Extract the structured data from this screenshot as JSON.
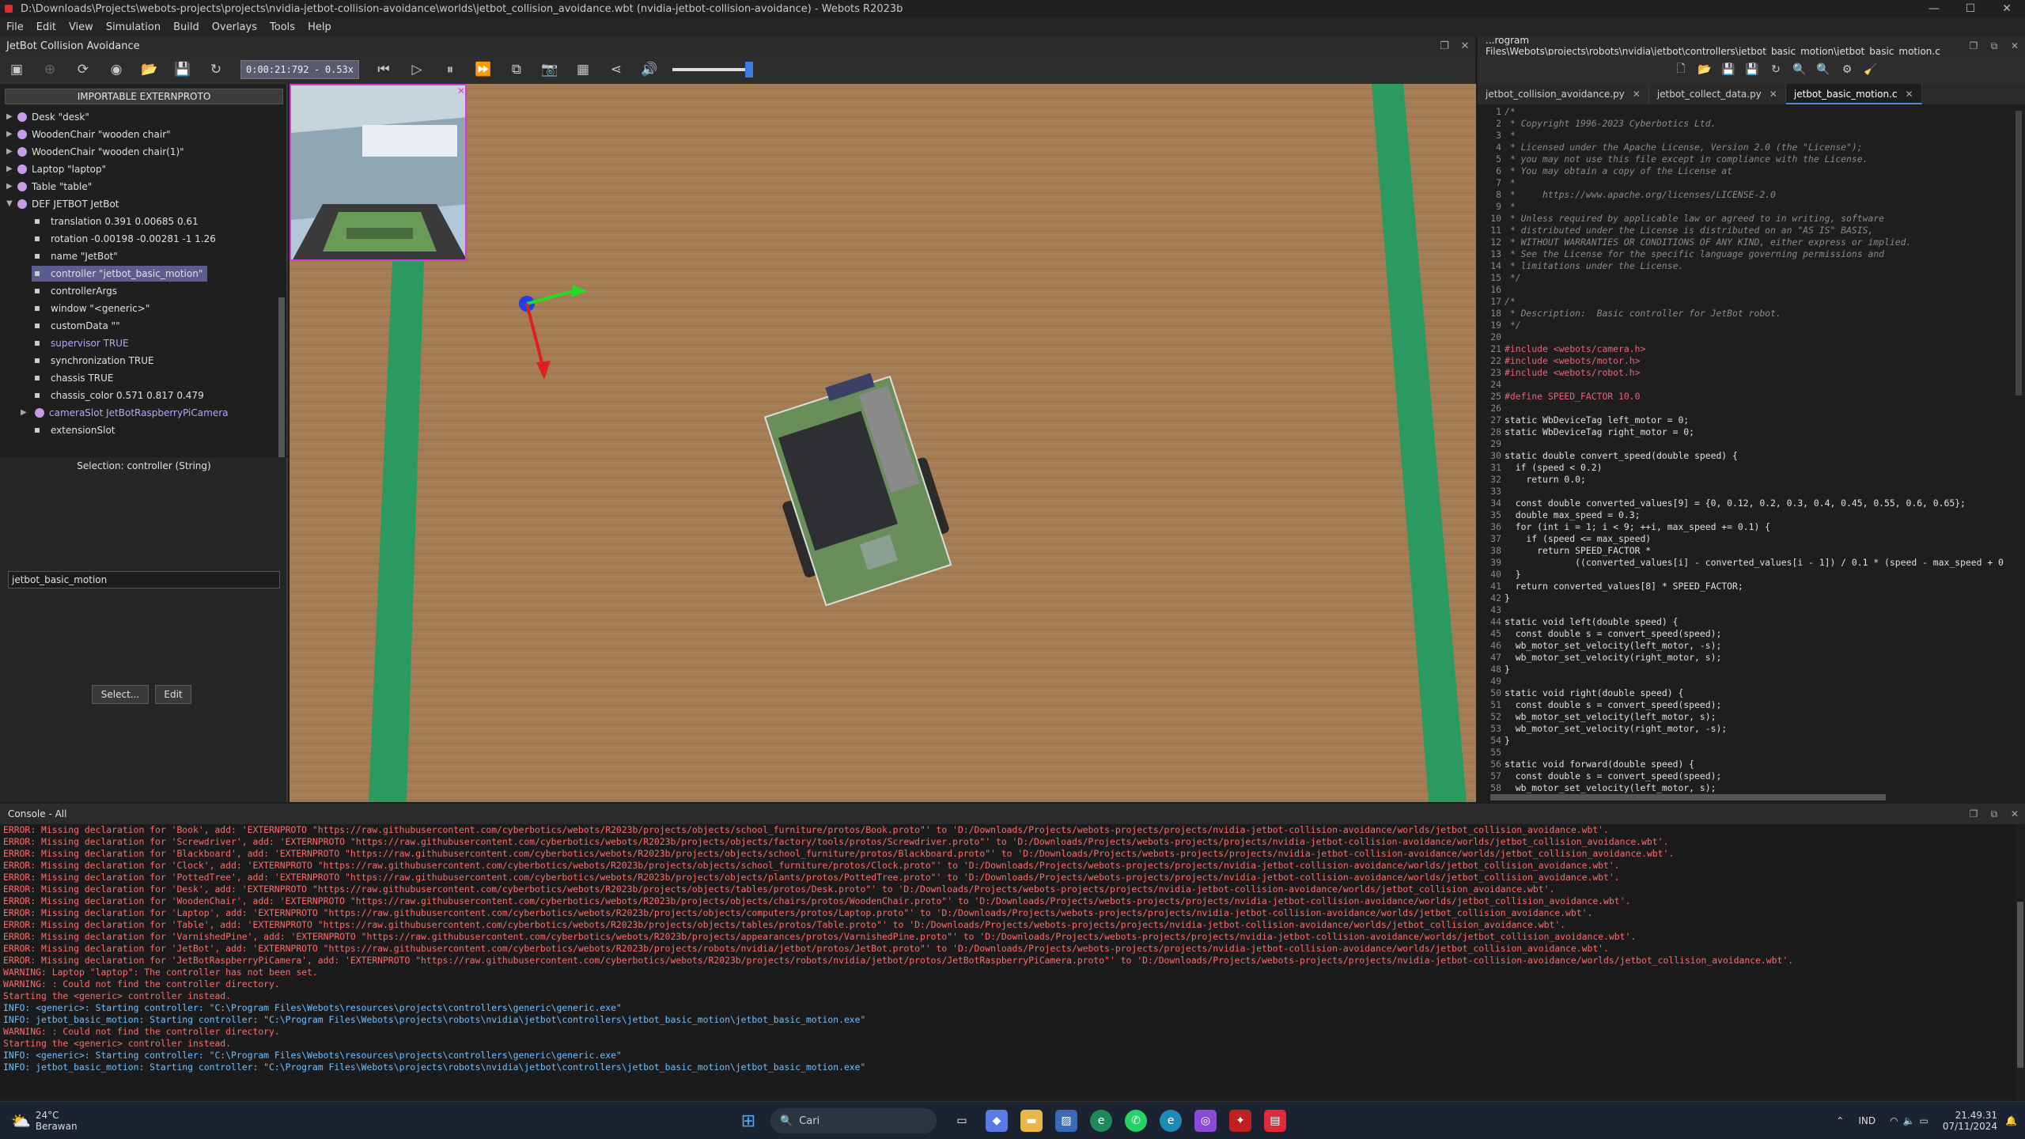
{
  "window": {
    "title": "D:\\Downloads\\Projects\\webots-projects\\projects\\nvidia-jetbot-collision-avoidance\\worlds\\jetbot_collision_avoidance.wbt (nvidia-jetbot-collision-avoidance) - Webots R2023b",
    "minimize": "—",
    "maximize": "☐",
    "close": "✕"
  },
  "menu": [
    "File",
    "Edit",
    "View",
    "Simulation",
    "Build",
    "Overlays",
    "Tools",
    "Help"
  ],
  "scene_window": {
    "title": "JetBot Collision Avoidance"
  },
  "toolbar": {
    "time": "0:00:21:792",
    "speed": "0.53x",
    "separator": "-"
  },
  "tree": {
    "header": "IMPORTABLE EXTERNPROTO",
    "nodes": [
      "Desk \"desk\"",
      "WoodenChair \"wooden chair\"",
      "WoodenChair \"wooden chair(1)\"",
      "Laptop \"laptop\"",
      "Table \"table\"",
      "DEF JETBOT JetBot"
    ],
    "fields": [
      "translation 0.391 0.00685 0.61",
      "rotation -0.00198 -0.00281 -1 1.26",
      "name \"JetBot\"",
      "controller \"jetbot_basic_motion\"",
      "controllerArgs",
      "window \"<generic>\"",
      "customData \"\"",
      "supervisor TRUE",
      "synchronization TRUE",
      "chassis TRUE",
      "chassis_color 0.571 0.817 0.479",
      "cameraSlot JetBotRaspberryPiCamera",
      "extensionSlot"
    ]
  },
  "field_editor": {
    "selection": "Selection: controller (String)",
    "value": "jetbot_basic_motion",
    "select_button": "Select...",
    "edit_button": "Edit"
  },
  "editor": {
    "title": "...rogram Files\\Webots\\projects\\robots\\nvidia\\jetbot\\controllers\\jetbot_basic_motion\\jetbot_basic_motion.c",
    "tabs": [
      "jetbot_collision_avoidance.py",
      "jetbot_collect_data.py",
      "jetbot_basic_motion.c"
    ],
    "tab_close": "✕",
    "lines": [
      "/*",
      " * Copyright 1996-2023 Cyberbotics Ltd.",
      " *",
      " * Licensed under the Apache License, Version 2.0 (the \"License\");",
      " * you may not use this file except in compliance with the License.",
      " * You may obtain a copy of the License at",
      " *",
      " *     https://www.apache.org/licenses/LICENSE-2.0",
      " *",
      " * Unless required by applicable law or agreed to in writing, software",
      " * distributed under the License is distributed on an \"AS IS\" BASIS,",
      " * WITHOUT WARRANTIES OR CONDITIONS OF ANY KIND, either express or implied.",
      " * See the License for the specific language governing permissions and",
      " * limitations under the License.",
      " */",
      "",
      "/*",
      " * Description:  Basic controller for JetBot robot.",
      " */",
      "",
      "#include <webots/camera.h>",
      "#include <webots/motor.h>",
      "#include <webots/robot.h>",
      "",
      "#define SPEED_FACTOR 10.0",
      "",
      "static WbDeviceTag left_motor = 0;",
      "static WbDeviceTag right_motor = 0;",
      "",
      "static double convert_speed(double speed) {",
      "  if (speed < 0.2)",
      "    return 0.0;",
      "",
      "  const double converted_values[9] = {0, 0.12, 0.2, 0.3, 0.4, 0.45, 0.55, 0.6, 0.65};",
      "  double max_speed = 0.3;",
      "  for (int i = 1; i < 9; ++i, max_speed += 0.1) {",
      "    if (speed <= max_speed)",
      "      return SPEED_FACTOR *",
      "             ((converted_values[i] - converted_values[i - 1]) / 0.1 * (speed - max_speed + 0",
      "  }",
      "  return converted_values[8] * SPEED_FACTOR;",
      "}",
      "",
      "static void left(double speed) {",
      "  const double s = convert_speed(speed);",
      "  wb_motor_set_velocity(left_motor, -s);",
      "  wb_motor_set_velocity(right_motor, s);",
      "}",
      "",
      "static void right(double speed) {",
      "  const double s = convert_speed(speed);",
      "  wb_motor_set_velocity(left_motor, s);",
      "  wb_motor_set_velocity(right_motor, -s);",
      "}",
      "",
      "static void forward(double speed) {",
      "  const double s = convert_speed(speed);",
      "  wb_motor_set_velocity(left_motor, s);"
    ]
  },
  "console": {
    "title": "Console - All",
    "lines": [
      {
        "type": "err",
        "text": "ERROR: Missing declaration for 'Book', add: 'EXTERNPROTO \"https://raw.githubusercontent.com/cyberbotics/webots/R2023b/projects/objects/school_furniture/protos/Book.proto\"' to 'D:/Downloads/Projects/webots-projects/projects/nvidia-jetbot-collision-avoidance/worlds/jetbot_collision_avoidance.wbt'."
      },
      {
        "type": "err",
        "text": "ERROR: Missing declaration for 'Screwdriver', add: 'EXTERNPROTO \"https://raw.githubusercontent.com/cyberbotics/webots/R2023b/projects/objects/factory/tools/protos/Screwdriver.proto\"' to 'D:/Downloads/Projects/webots-projects/projects/nvidia-jetbot-collision-avoidance/worlds/jetbot_collision_avoidance.wbt'."
      },
      {
        "type": "err",
        "text": "ERROR: Missing declaration for 'Blackboard', add: 'EXTERNPROTO \"https://raw.githubusercontent.com/cyberbotics/webots/R2023b/projects/objects/school_furniture/protos/Blackboard.proto\"' to 'D:/Downloads/Projects/webots-projects/projects/nvidia-jetbot-collision-avoidance/worlds/jetbot_collision_avoidance.wbt'."
      },
      {
        "type": "err",
        "text": "ERROR: Missing declaration for 'Clock', add: 'EXTERNPROTO \"https://raw.githubusercontent.com/cyberbotics/webots/R2023b/projects/objects/school_furniture/protos/Clock.proto\"' to 'D:/Downloads/Projects/webots-projects/projects/nvidia-jetbot-collision-avoidance/worlds/jetbot_collision_avoidance.wbt'."
      },
      {
        "type": "err",
        "text": "ERROR: Missing declaration for 'PottedTree', add: 'EXTERNPROTO \"https://raw.githubusercontent.com/cyberbotics/webots/R2023b/projects/objects/plants/protos/PottedTree.proto\"' to 'D:/Downloads/Projects/webots-projects/projects/nvidia-jetbot-collision-avoidance/worlds/jetbot_collision_avoidance.wbt'."
      },
      {
        "type": "err",
        "text": "ERROR: Missing declaration for 'Desk', add: 'EXTERNPROTO \"https://raw.githubusercontent.com/cyberbotics/webots/R2023b/projects/objects/tables/protos/Desk.proto\"' to 'D:/Downloads/Projects/webots-projects/projects/nvidia-jetbot-collision-avoidance/worlds/jetbot_collision_avoidance.wbt'."
      },
      {
        "type": "err",
        "text": "ERROR: Missing declaration for 'WoodenChair', add: 'EXTERNPROTO \"https://raw.githubusercontent.com/cyberbotics/webots/R2023b/projects/objects/chairs/protos/WoodenChair.proto\"' to 'D:/Downloads/Projects/webots-projects/projects/nvidia-jetbot-collision-avoidance/worlds/jetbot_collision_avoidance.wbt'."
      },
      {
        "type": "err",
        "text": "ERROR: Missing declaration for 'Laptop', add: 'EXTERNPROTO \"https://raw.githubusercontent.com/cyberbotics/webots/R2023b/projects/objects/computers/protos/Laptop.proto\"' to 'D:/Downloads/Projects/webots-projects/projects/nvidia-jetbot-collision-avoidance/worlds/jetbot_collision_avoidance.wbt'."
      },
      {
        "type": "err",
        "text": "ERROR: Missing declaration for 'Table', add: 'EXTERNPROTO \"https://raw.githubusercontent.com/cyberbotics/webots/R2023b/projects/objects/tables/protos/Table.proto\"' to 'D:/Downloads/Projects/webots-projects/projects/nvidia-jetbot-collision-avoidance/worlds/jetbot_collision_avoidance.wbt'."
      },
      {
        "type": "err",
        "text": "ERROR: Missing declaration for 'VarnishedPine', add: 'EXTERNPROTO \"https://raw.githubusercontent.com/cyberbotics/webots/R2023b/projects/appearances/protos/VarnishedPine.proto\"' to 'D:/Downloads/Projects/webots-projects/projects/nvidia-jetbot-collision-avoidance/worlds/jetbot_collision_avoidance.wbt'."
      },
      {
        "type": "err",
        "text": "ERROR: Missing declaration for 'JetBot', add: 'EXTERNPROTO \"https://raw.githubusercontent.com/cyberbotics/webots/R2023b/projects/robots/nvidia/jetbot/protos/JetBot.proto\"' to 'D:/Downloads/Projects/webots-projects/projects/nvidia-jetbot-collision-avoidance/worlds/jetbot_collision_avoidance.wbt'."
      },
      {
        "type": "err",
        "text": "ERROR: Missing declaration for 'JetBotRaspberryPiCamera', add: 'EXTERNPROTO \"https://raw.githubusercontent.com/cyberbotics/webots/R2023b/projects/robots/nvidia/jetbot/protos/JetBotRaspberryPiCamera.proto\"' to 'D:/Downloads/Projects/webots-projects/projects/nvidia-jetbot-collision-avoidance/worlds/jetbot_collision_avoidance.wbt'."
      },
      {
        "type": "warn",
        "text": "WARNING: Laptop \"laptop\": The controller has not been set."
      },
      {
        "type": "warn",
        "text": "WARNING: : Could not find the controller directory."
      },
      {
        "type": "plain",
        "text": "Starting the <generic> controller instead."
      },
      {
        "type": "info",
        "text": "INFO: <generic>: Starting controller: \"C:\\Program Files\\Webots\\resources\\projects\\controllers\\generic\\generic.exe\""
      },
      {
        "type": "info",
        "text": "INFO: jetbot_basic_motion: Starting controller: \"C:\\Program Files\\Webots\\projects\\robots\\nvidia\\jetbot\\controllers\\jetbot_basic_motion\\jetbot_basic_motion.exe\""
      },
      {
        "type": "warn",
        "text": "WARNING: : Could not find the controller directory."
      },
      {
        "type": "plain",
        "text": "Starting the <generic> controller instead."
      },
      {
        "type": "info",
        "text": "INFO: <generic>: Starting controller: \"C:\\Program Files\\Webots\\resources\\projects\\controllers\\generic\\generic.exe\""
      },
      {
        "type": "info",
        "text": "INFO: jetbot_basic_motion: Starting controller: \"C:\\Program Files\\Webots\\projects\\robots\\nvidia\\jetbot\\controllers\\jetbot_basic_motion\\jetbot_basic_motion.exe\""
      }
    ]
  },
  "taskbar": {
    "temp": "24°C",
    "weather": "Berawan",
    "search": "Cari",
    "lang": "IND",
    "time": "21.49.31",
    "date": "07/11/2024"
  }
}
